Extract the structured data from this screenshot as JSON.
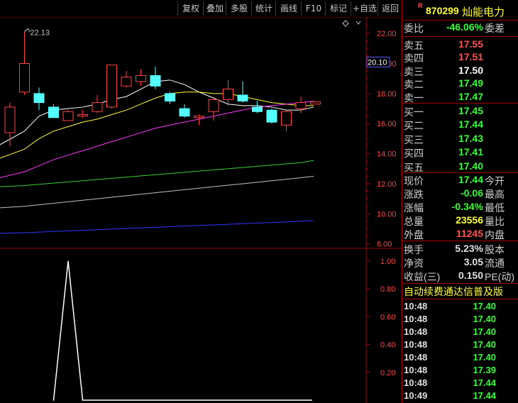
{
  "toolbar": {
    "buttons": [
      "复权",
      "叠加",
      "多股",
      "统计",
      "画线",
      "F10",
      "标记",
      "+自选",
      "返回"
    ]
  },
  "stock": {
    "flag": "R",
    "code": "870299",
    "name": "灿能电力"
  },
  "order_ratio": {
    "label": "委比",
    "value": "-46.06%",
    "right_label": "委差"
  },
  "asks": [
    {
      "label": "卖五",
      "price": "17.55",
      "color": "#ff5050"
    },
    {
      "label": "卖四",
      "price": "17.51",
      "color": "#ff5050"
    },
    {
      "label": "卖三",
      "price": "17.50",
      "color": "#ffffff"
    },
    {
      "label": "卖二",
      "price": "17.49",
      "color": "#33ff33"
    },
    {
      "label": "卖一",
      "price": "17.47",
      "color": "#33ff33"
    }
  ],
  "bids": [
    {
      "label": "买一",
      "price": "17.45",
      "color": "#33ff33"
    },
    {
      "label": "买二",
      "price": "17.44",
      "color": "#33ff33"
    },
    {
      "label": "买三",
      "price": "17.43",
      "color": "#33ff33"
    },
    {
      "label": "买四",
      "price": "17.41",
      "color": "#33ff33"
    },
    {
      "label": "买五",
      "price": "17.40",
      "color": "#33ff33"
    }
  ],
  "stats": [
    {
      "label": "现价",
      "value": "17.44",
      "right": "今开",
      "color": "#33ff33"
    },
    {
      "label": "涨跌",
      "value": "-0.06",
      "right": "最高",
      "color": "#33ff33"
    },
    {
      "label": "涨幅",
      "value": "-0.34%",
      "right": "最低",
      "color": "#33ff33"
    },
    {
      "label": "总量",
      "value": "23556",
      "right": "量比",
      "color": "#ffff33"
    },
    {
      "label": "外盘",
      "value": "11245",
      "right": "内盘",
      "color": "#ff5050"
    }
  ],
  "stats2": [
    {
      "label": "换手",
      "value": "5.23%",
      "right": "股本",
      "color": "#e0e0e0"
    },
    {
      "label": "净资",
      "value": "3.05",
      "right": "流通",
      "color": "#e0e0e0"
    },
    {
      "label": "收益(三)",
      "value": "0.150",
      "right": "PE(动)",
      "color": "#e0e0e0"
    }
  ],
  "banner": "自动续费通达信普及版",
  "ticks": [
    {
      "time": "10:48",
      "price": "17.40"
    },
    {
      "time": "10:48",
      "price": "17.40"
    },
    {
      "time": "10:48",
      "price": "17.40"
    },
    {
      "time": "10:48",
      "price": "17.40"
    },
    {
      "time": "10:48",
      "price": "17.40"
    },
    {
      "time": "10:48",
      "price": "17.39"
    },
    {
      "time": "10:48",
      "price": "17.44"
    },
    {
      "time": "10:49",
      "price": "17.44"
    }
  ],
  "chart_data": {
    "type": "candlestick",
    "price_axis": {
      "ticks": [
        "22.00",
        "20.00",
        "18.00",
        "16.00",
        "14.00",
        "12.00",
        "10.00",
        "8.00"
      ],
      "ylim": [
        7.7,
        23.0
      ]
    },
    "current_price_label": "20.10",
    "max_annotation": "22.13",
    "colors": {
      "up": "#ff4040",
      "down": "#54ffff",
      "ma5": "#ffffff",
      "ma10": "#ffff33",
      "ma20": "#ff33ff",
      "ma60": "#33cc33",
      "ma120": "#c0c0c0",
      "ma250": "#3333ff"
    },
    "candles": [
      {
        "o": 15.4,
        "h": 17.4,
        "l": 14.5,
        "c": 17.1
      },
      {
        "o": 18.1,
        "h": 22.13,
        "l": 17.9,
        "c": 20.0
      },
      {
        "o": 18.0,
        "h": 18.4,
        "l": 16.9,
        "c": 17.4
      },
      {
        "o": 17.1,
        "h": 17.3,
        "l": 16.4,
        "c": 16.4
      },
      {
        "o": 16.2,
        "h": 16.9,
        "l": 16.2,
        "c": 16.8
      },
      {
        "o": 16.5,
        "h": 16.9,
        "l": 16.4,
        "c": 16.6
      },
      {
        "o": 16.8,
        "h": 17.9,
        "l": 16.7,
        "c": 17.4
      },
      {
        "o": 17.1,
        "h": 19.9,
        "l": 17.0,
        "c": 19.9
      },
      {
        "o": 18.5,
        "h": 19.5,
        "l": 18.4,
        "c": 19.1
      },
      {
        "o": 18.8,
        "h": 19.6,
        "l": 18.5,
        "c": 19.2
      },
      {
        "o": 19.2,
        "h": 19.8,
        "l": 18.3,
        "c": 18.5
      },
      {
        "o": 18.0,
        "h": 18.1,
        "l": 17.3,
        "c": 17.5
      },
      {
        "o": 17.0,
        "h": 17.3,
        "l": 16.4,
        "c": 16.5
      },
      {
        "o": 16.4,
        "h": 16.6,
        "l": 15.9,
        "c": 16.5
      },
      {
        "o": 16.8,
        "h": 17.7,
        "l": 16.2,
        "c": 17.6
      },
      {
        "o": 17.6,
        "h": 18.9,
        "l": 17.2,
        "c": 18.3
      },
      {
        "o": 17.9,
        "h": 18.8,
        "l": 17.4,
        "c": 17.5
      },
      {
        "o": 17.1,
        "h": 17.5,
        "l": 16.7,
        "c": 16.8
      },
      {
        "o": 16.9,
        "h": 17.0,
        "l": 16.0,
        "c": 16.1
      },
      {
        "o": 15.9,
        "h": 16.9,
        "l": 15.5,
        "c": 16.8
      },
      {
        "o": 17.0,
        "h": 17.8,
        "l": 16.7,
        "c": 17.4
      },
      {
        "o": 17.3,
        "h": 17.5,
        "l": 17.3,
        "c": 17.44
      }
    ],
    "ma_lines": [
      {
        "key": "ma5",
        "values": [
          14.6,
          15.5,
          16.5,
          16.9,
          17.0,
          17.1,
          17.3,
          17.6,
          17.8,
          18.3,
          18.8,
          18.9,
          18.6,
          18.1,
          17.7,
          17.3,
          17.2,
          17.2,
          17.1,
          16.9,
          16.9,
          17.1
        ]
      },
      {
        "key": "ma10",
        "values": [
          13.7,
          14.3,
          15.0,
          15.5,
          15.8,
          16.1,
          16.3,
          16.6,
          16.9,
          17.3,
          17.7,
          18.0,
          18.1,
          18.1,
          18.0,
          18.0,
          17.8,
          17.6,
          17.4,
          17.3,
          17.2,
          17.2
        ]
      },
      {
        "key": "ma20",
        "values": [
          12.4,
          12.8,
          13.2,
          13.6,
          13.9,
          14.2,
          14.5,
          14.8,
          15.1,
          15.4,
          15.7,
          15.9,
          16.1,
          16.3,
          16.5,
          16.7,
          16.9,
          17.1,
          17.2,
          17.3,
          17.4,
          17.5
        ]
      },
      {
        "key": "ma60",
        "values": [
          11.8,
          11.88,
          11.96,
          12.04,
          12.12,
          12.2,
          12.28,
          12.36,
          12.44,
          12.52,
          12.6,
          12.68,
          12.76,
          12.84,
          12.92,
          13.0,
          13.08,
          13.16,
          13.24,
          13.32,
          13.4,
          13.55
        ]
      },
      {
        "key": "ma120",
        "values": [
          10.4,
          10.5,
          10.6,
          10.7,
          10.8,
          10.9,
          11.0,
          11.1,
          11.2,
          11.3,
          11.4,
          11.5,
          11.6,
          11.7,
          11.8,
          11.9,
          12.0,
          12.1,
          12.2,
          12.3,
          12.4,
          12.5
        ]
      },
      {
        "key": "ma250",
        "values": [
          8.7,
          8.74,
          8.78,
          8.82,
          8.86,
          8.9,
          8.94,
          8.98,
          9.02,
          9.06,
          9.1,
          9.14,
          9.18,
          9.22,
          9.26,
          9.3,
          9.34,
          9.38,
          9.42,
          9.46,
          9.5,
          9.55
        ]
      }
    ],
    "indicator": {
      "axis_ticks": [
        "1.00",
        "0.80",
        "0.60",
        "0.40",
        "0.20"
      ],
      "ylim": [
        0,
        1.05
      ],
      "values": [
        0,
        0,
        0,
        0,
        1,
        0,
        0,
        0,
        0,
        0,
        0,
        0,
        0,
        0,
        0,
        0,
        0,
        0,
        0,
        0,
        0,
        0
      ]
    }
  }
}
